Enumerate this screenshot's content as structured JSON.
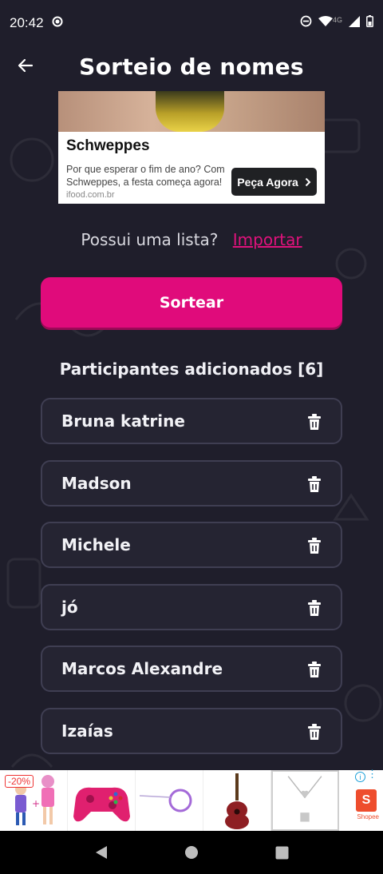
{
  "status_bar": {
    "time": "20:42",
    "network": "4G"
  },
  "header": {
    "title": "Sorteio de nomes"
  },
  "ad": {
    "title": "Schweppes",
    "text": "Por que esperar o fim de ano? Com Schweppes, a festa começa agora!",
    "domain": "ifood.com.br",
    "cta": "Peça Agora"
  },
  "import_row": {
    "question": "Possui uma lista?",
    "link": "Importar"
  },
  "draw_button": {
    "label": "Sortear"
  },
  "participants": {
    "title": "Participantes adicionados [6]",
    "items": [
      {
        "name": "Bruna katrine"
      },
      {
        "name": "Madson"
      },
      {
        "name": "Michele"
      },
      {
        "name": "jó"
      },
      {
        "name": "Marcos Alexandre"
      },
      {
        "name": "Izaías"
      }
    ]
  },
  "bottom_ad": {
    "discount": "-20%",
    "brand": "Shopee",
    "brand_initial": "S"
  },
  "colors": {
    "background": "#1f1e2b",
    "accent": "#e00b7b",
    "item_bg": "#252432",
    "item_border": "#3f3e52"
  }
}
